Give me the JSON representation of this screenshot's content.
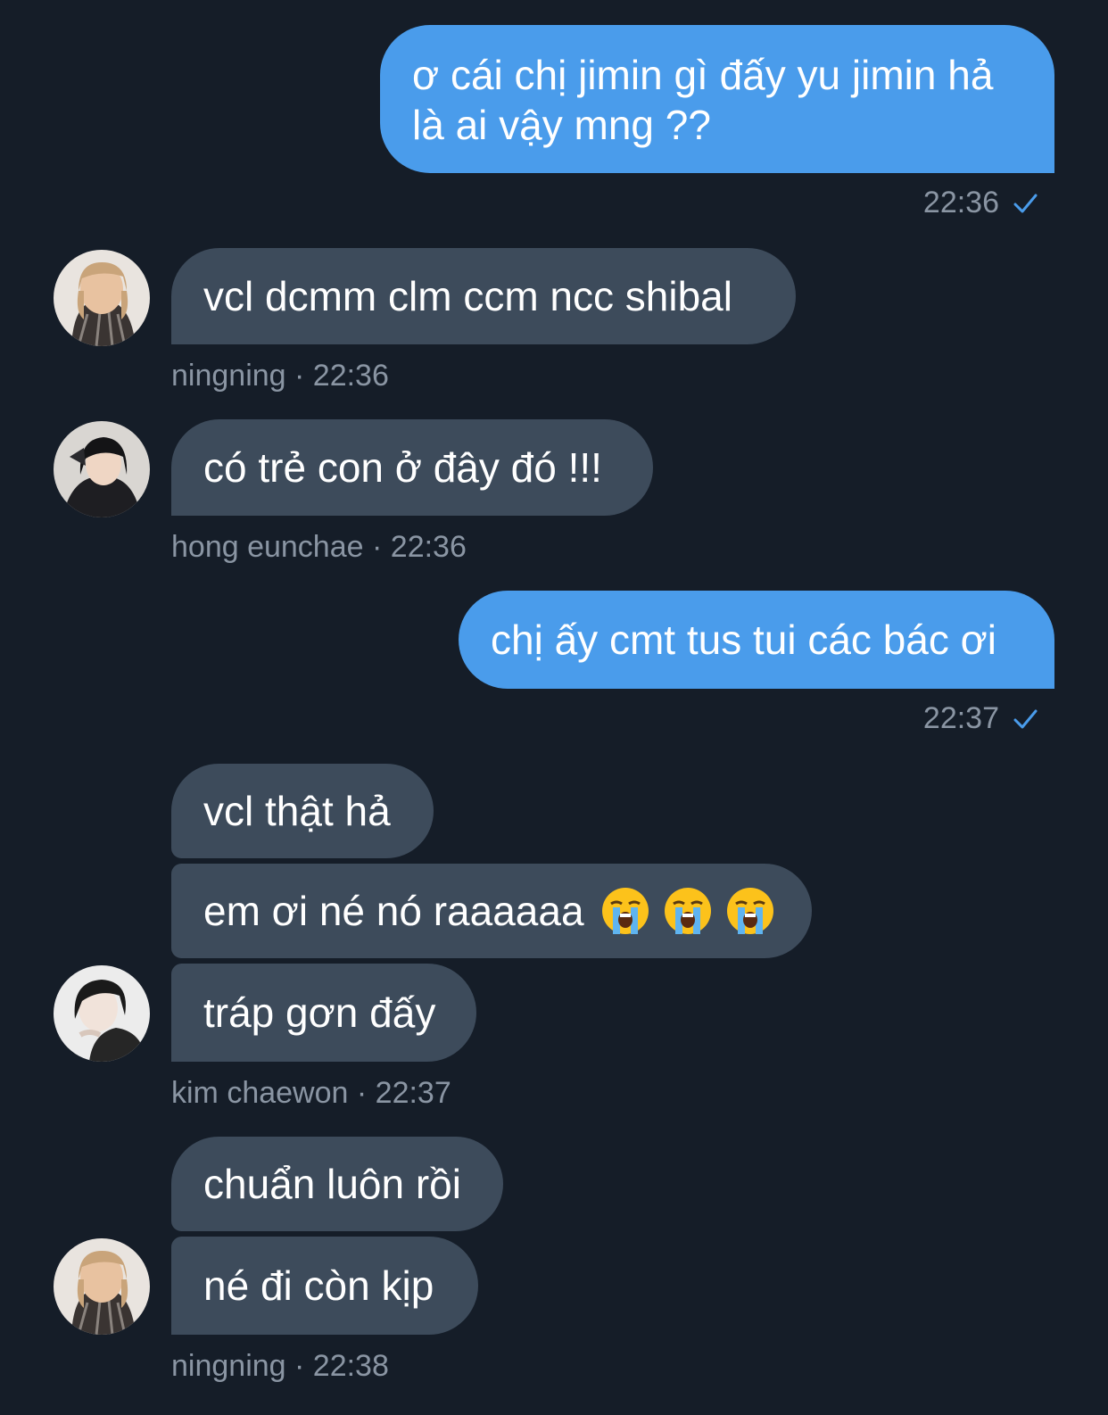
{
  "colors": {
    "background": "#151d28",
    "outgoing_bubble": "#4a9ceb",
    "incoming_bubble": "#3d4b5b",
    "meta_text": "#8a95a3",
    "check": "#4a9ceb"
  },
  "messages": {
    "m1": {
      "text_line1": "ơ cái chị jimin gì đấy yu jimin hả",
      "text_line2": "là ai vậy mng ??",
      "time": "22:36"
    },
    "m2": {
      "text": "vcl dcmm clm ccm ncc shibal",
      "sender": "ningning",
      "time": "22:36"
    },
    "m3": {
      "text": "có trẻ con ở đây đó !!!",
      "sender": "hong eunchae",
      "time": "22:36"
    },
    "m4": {
      "text": "chị ấy cmt tus tui các bác ơi",
      "time": "22:37"
    },
    "m5": {
      "texts": [
        "vcl thật hả",
        "em ơi né nó raaaaaa",
        "tráp gơn đấy"
      ],
      "emoji": "loudly-crying-face",
      "emoji_count": 3,
      "sender": "kim chaewon",
      "time": "22:37"
    },
    "m6": {
      "texts": [
        "chuẩn luôn rồi",
        "né đi còn kịp"
      ],
      "sender": "ningning",
      "time": "22:38"
    }
  },
  "separator": "·",
  "icons": {
    "read": "checkmark-icon"
  }
}
